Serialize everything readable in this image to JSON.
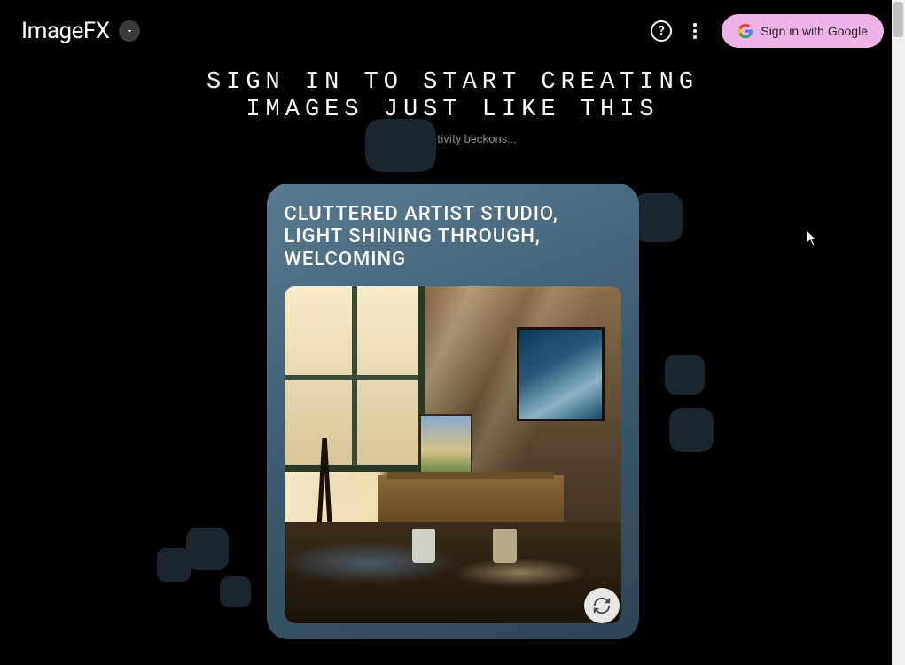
{
  "header": {
    "logo": "ImageFX",
    "signin_label": "Sign in with Google"
  },
  "hero": {
    "title_line1": "SIGN IN TO START CREATING",
    "title_line2": "IMAGES JUST LIKE THIS",
    "subtitle": "Your creativity beckons..."
  },
  "card": {
    "prompt": "CLUTTERED ARTIST STUDIO, LIGHT SHINING THROUGH, WELCOMING"
  }
}
